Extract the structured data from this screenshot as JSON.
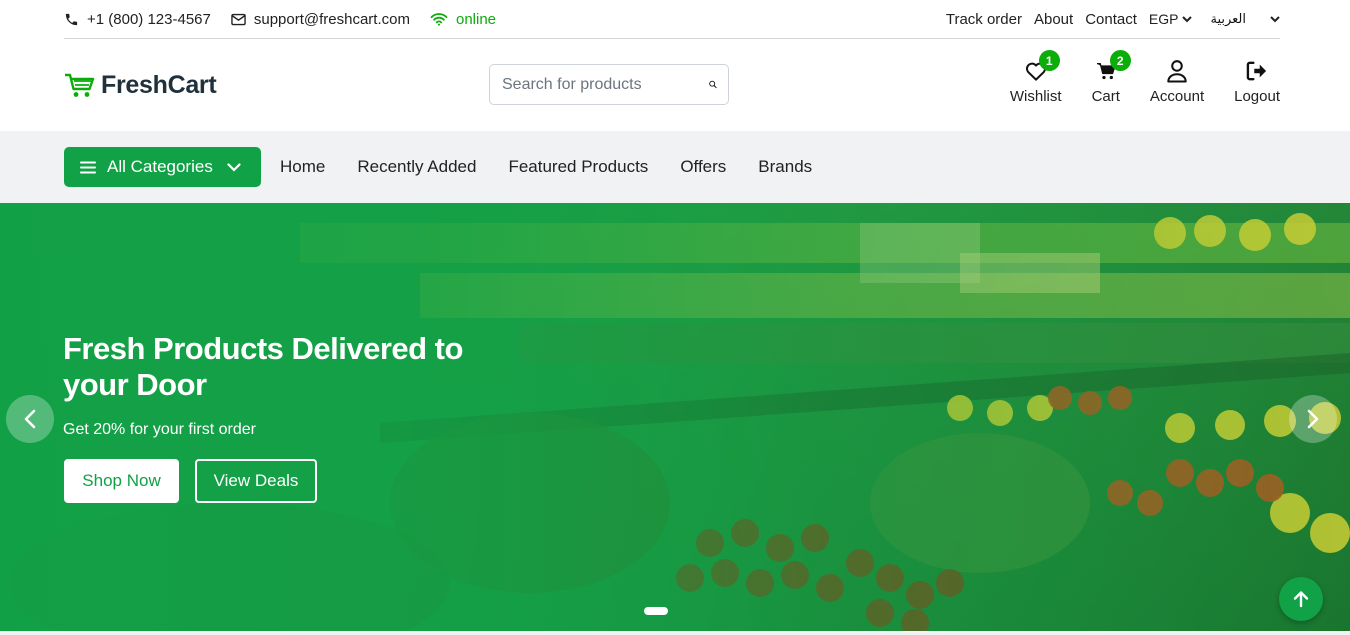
{
  "topbar": {
    "phone": "+1 (800) 123-4567",
    "email": "support@freshcart.com",
    "status": "online",
    "links": [
      "Track order",
      "About",
      "Contact"
    ],
    "currency": "EGP",
    "language": "العربية"
  },
  "header": {
    "brand": "FreshCart",
    "search_placeholder": "Search for products",
    "icons": {
      "wishlist": {
        "label": "Wishlist",
        "count": "1"
      },
      "cart": {
        "label": "Cart",
        "count": "2"
      },
      "account": {
        "label": "Account"
      },
      "logout": {
        "label": "Logout"
      }
    }
  },
  "nav": {
    "categories_label": "All Categories",
    "links": [
      "Home",
      "Recently Added",
      "Featured Products",
      "Offers",
      "Brands"
    ]
  },
  "hero": {
    "title": "Fresh Products Delivered to your Door",
    "subtitle": "Get 20% for your first order",
    "primary_cta": "Shop Now",
    "secondary_cta": "View Deals"
  },
  "colors": {
    "brand_green": "#11a146",
    "accent_green": "#0aad0a",
    "nav_bg": "#f1f2f4"
  }
}
